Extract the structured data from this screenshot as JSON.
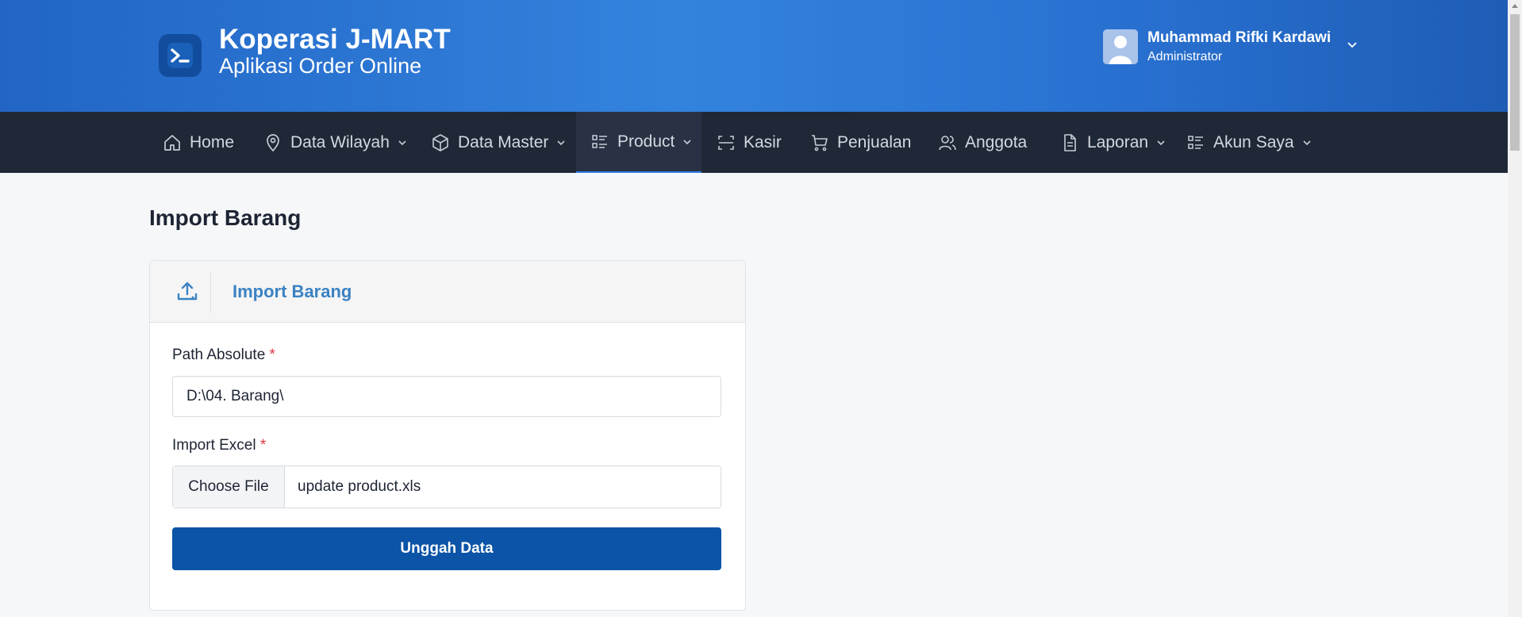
{
  "app": {
    "name": "Koperasi J-MART",
    "subtitle": "Aplikasi Order Online"
  },
  "user": {
    "name": "Muhammad Rifki Kardawi",
    "role": "Administrator"
  },
  "nav": {
    "items": [
      {
        "label": "Home",
        "icon": "home-icon",
        "dropdown": false
      },
      {
        "label": "Data Wilayah",
        "icon": "map-pin-icon",
        "dropdown": true
      },
      {
        "label": "Data Master",
        "icon": "box-icon",
        "dropdown": true
      },
      {
        "label": "Product",
        "icon": "list-icon",
        "dropdown": true,
        "active": true
      },
      {
        "label": "Kasir",
        "icon": "scan-icon",
        "dropdown": false
      },
      {
        "label": "Penjualan",
        "icon": "cart-icon",
        "dropdown": false
      },
      {
        "label": "Anggota",
        "icon": "users-icon",
        "dropdown": false
      },
      {
        "label": "Laporan",
        "icon": "document-icon",
        "dropdown": true
      },
      {
        "label": "Akun Saya",
        "icon": "list-icon",
        "dropdown": true
      }
    ]
  },
  "page": {
    "title": "Import Barang"
  },
  "card": {
    "title": "Import Barang",
    "path_label": "Path Absolute",
    "path_value": "D:\\04. Barang\\",
    "required_mark": "*",
    "excel_label": "Import Excel",
    "file_button": "Choose File",
    "file_name": "update product.xls",
    "submit_label": "Unggah Data"
  },
  "colors": {
    "header_gradient_start": "#2265c5",
    "header_gradient_mid": "#3383dd",
    "navbar": "#1f2837",
    "accent": "#3b82c4",
    "primary_button": "#0b54a7",
    "required": "#dc3545"
  }
}
